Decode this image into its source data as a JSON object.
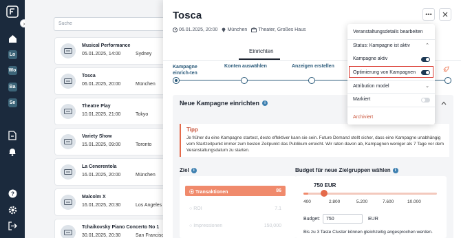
{
  "list": {
    "search_placeholder": "Suche",
    "events": [
      {
        "name": "Musical Performance",
        "datetime": "05.01.2025, 14:00",
        "city": "Sydney"
      },
      {
        "name": "Tosca",
        "datetime": "06.01.2025, 20:00",
        "city": "München"
      },
      {
        "name": "Theatre Play",
        "datetime": "10.01.2025, 21:00",
        "city": "Tokyo"
      },
      {
        "name": "Variety Show",
        "datetime": "15.01.2025, 09:00",
        "city": "Toronto"
      },
      {
        "name": "La Cenerentola",
        "datetime": "16.01.2025, 20:00",
        "city": "München"
      },
      {
        "name": "Malcolm X",
        "datetime": "16.01.2025, 20:30",
        "city": "Los Angeles"
      },
      {
        "name": "Tchaikovsky Piano Concerto No 1",
        "datetime": "30.01.2025, 20:30",
        "city": "San Francisco"
      }
    ]
  },
  "rail": {
    "badges": [
      "Lo",
      "Wo",
      "Ba",
      "Se"
    ]
  },
  "panel": {
    "title": "Tosca",
    "date": "06.01.2025, 20:00",
    "city": "München",
    "venue": "Theater, Großes Haus",
    "tab": "Einrichten",
    "steps": [
      "Kampagne einrich-ten",
      "Konten auswählen",
      "Anzeigen erstellen"
    ],
    "section_title": "Neue Kampagne einrichten",
    "tip_title": "Tipp",
    "tip_text": "Je früher du eine Kampagne startest, desto effektiver kann sie sein. Future Demand stellt sicher, dass eine Kampagne unabhängig vom Startzeitpunkt immer zum besten Zeitpunkt das Publikum erreicht. Wir raten davon ab, Kampagnen weniger als 7 Tage vor dem Veranstaltungsdatum zu starten.",
    "goal_title": "Ziel",
    "goals": [
      {
        "label": "Transaktionen",
        "value": "86"
      },
      {
        "label": "ROI",
        "value": "7.1"
      },
      {
        "label": "Impressionen",
        "value": "150,000"
      }
    ],
    "budget_title": "Budget für neue Zielgruppen wählen",
    "budget_display": "750 EUR",
    "budget_ticks": [
      "400",
      "2.800",
      "5.200",
      "7.600",
      "10.000"
    ],
    "budget_range": [
      400,
      10000
    ],
    "budget_value": 750,
    "budget_label": "Budget:",
    "budget_input": "750",
    "budget_unit": "EUR",
    "budget_note": "Bis zu 3 Taste Cluster können gleichzeitig angesprochen werden."
  },
  "menu": {
    "edit": "Veranstaltungsdetails bearbeiten",
    "status": "Status: Kampagne ist aktiv",
    "campaign_active": "Kampagne aktiv",
    "optimize": "Optimierung von Kampagnen",
    "attribution": "Attribution model",
    "marked": "Markiert",
    "archive": "Archiviert"
  },
  "colors": {
    "accent": "#f08a6c",
    "brand": "#1b2a3d",
    "highlight": "#d9342b"
  }
}
